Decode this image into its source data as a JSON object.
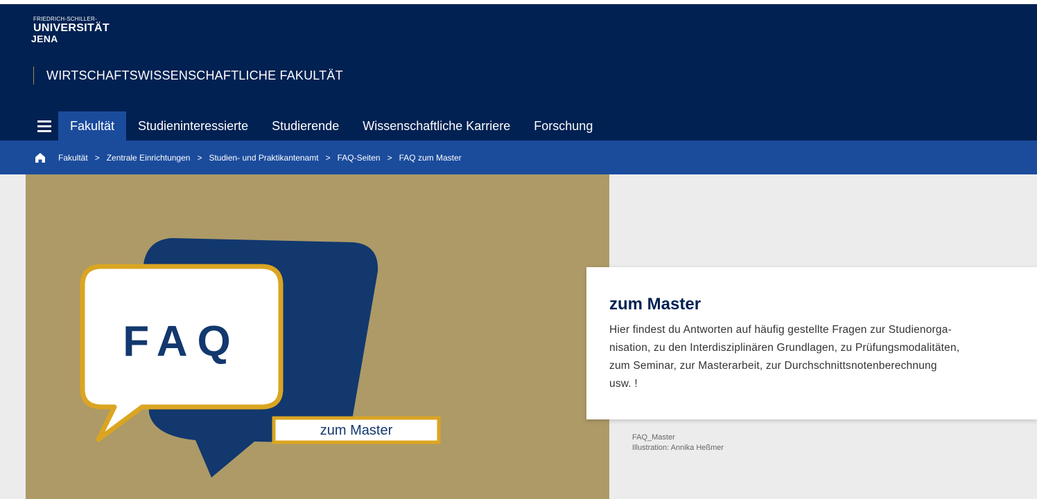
{
  "logo": {
    "line1": "FRIEDRICH-SCHILLER-",
    "line2": "UNIVERSITÄT",
    "line3": "JENA"
  },
  "faculty": {
    "name": "WIRTSCHAFTSWISSENSCHAFTLICHE FAKULTÄT"
  },
  "nav": {
    "items": [
      {
        "label": "Fakultät",
        "active": true
      },
      {
        "label": "Studieninteressierte"
      },
      {
        "label": "Studierende"
      },
      {
        "label": "Wissenschaftliche Karriere"
      },
      {
        "label": "Forschung"
      }
    ]
  },
  "breadcrumb": {
    "items": [
      "Fakultät",
      "Zentrale Einrichtungen",
      "Studien- und Praktikantenamt",
      "FAQ-Seiten",
      "FAQ zum Master"
    ],
    "separator": ">"
  },
  "hero": {
    "faq_text": "FAQ",
    "label": "zum Master"
  },
  "card": {
    "title": "zum Master",
    "lines": [
      "Hier findest du Antworten auf häufig gestellte Fragen zur Studienorga-",
      "nisation, zu den Interdisziplinären Grundlagen, zu Prüfungsmodalitäten,",
      "zum Seminar, zur Masterarbeit, zur Durchschnittsnotenberechnung",
      "usw. !"
    ]
  },
  "caption": {
    "line1": "FAQ_Master",
    "line2": "Illustration: Annika Heßmer"
  },
  "colors": {
    "header_bg": "#002152",
    "nav_active": "#1b4c9c",
    "hero_bg": "#ad9a67",
    "accent_gold": "#dba521"
  }
}
